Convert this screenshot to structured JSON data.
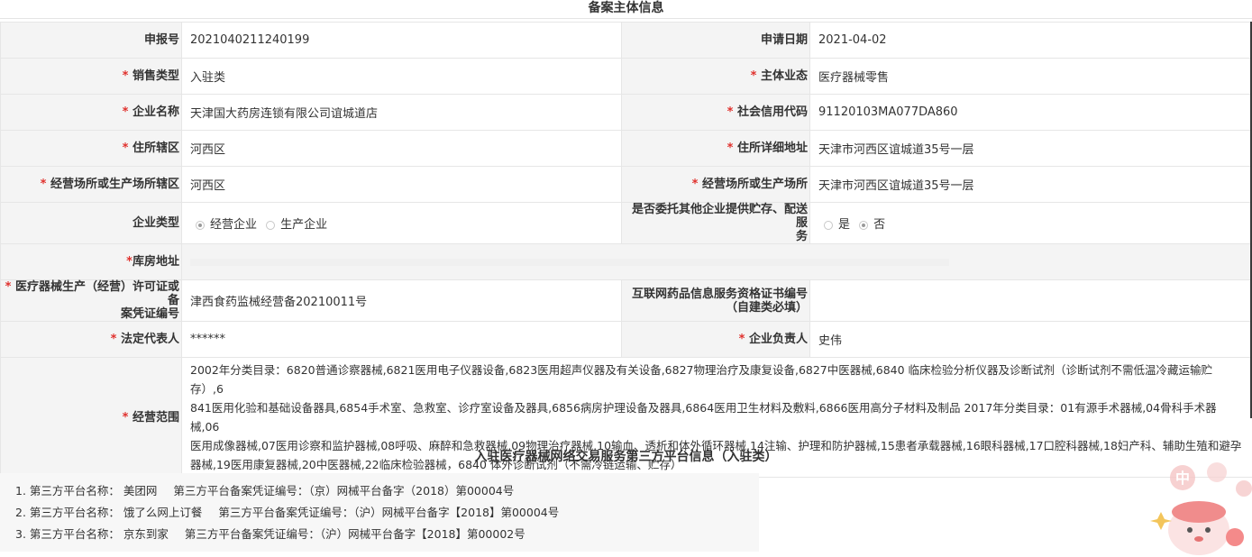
{
  "titles": {
    "main": "备案主体信息",
    "platforms": "入驻医疗器械网络交易服务第三方平台信息（入驻类）"
  },
  "required_mark": "*",
  "rows": {
    "report_no": {
      "label": "申报号",
      "value": "2021040211240199"
    },
    "apply_date": {
      "label": "申请日期",
      "value": "2021-04-02"
    },
    "sales_type": {
      "label": "销售类型",
      "value": "入驻类"
    },
    "business_format": {
      "label": "主体业态",
      "value": "医疗器械零售"
    },
    "company_name": {
      "label": "企业名称",
      "value": "天津国大药房连锁有限公司谊城道店"
    },
    "credit_code": {
      "label": "社会信用代码",
      "value": "91120103MA077DA860"
    },
    "residence_district": {
      "label": "住所辖区",
      "value": "河西区"
    },
    "residence_address": {
      "label": "住所详细地址",
      "value": "天津市河西区谊城道35号一层"
    },
    "premises_district": {
      "label": "经营场所或生产场所辖区",
      "value": "河西区"
    },
    "premises": {
      "label": "经营场所或生产场所",
      "value": "天津市河西区谊城道35号一层"
    },
    "company_type": {
      "label": "企业类型",
      "options": [
        {
          "label": "经营企业",
          "checked": true
        },
        {
          "label": "生产企业",
          "checked": false
        }
      ]
    },
    "entrust": {
      "label_line1": "是否委托其他企业提供贮存、配送服",
      "label_line2": "务",
      "options": [
        {
          "label": "是",
          "checked": false
        },
        {
          "label": "否",
          "checked": true
        }
      ]
    },
    "warehouse": {
      "label": "库房地址",
      "value": ""
    },
    "license": {
      "label_line1": "医疗器械生产（经营）许可证或备",
      "label_line2": "案凭证编号",
      "value": "津西食药监械经营备20210011号"
    },
    "internet_cert": {
      "label_line1": "互联网药品信息服务资格证书编号",
      "label_line2": "（自建类必填）",
      "value": ""
    },
    "legal_rep": {
      "label": "法定代表人",
      "value": "******"
    },
    "principal": {
      "label": "企业负责人",
      "value": "史伟"
    },
    "scope": {
      "label": "经营范围",
      "lines": [
        "2002年分类目录：6820普通诊察器械,6821医用电子仪器设备,6823医用超声仪器及有关设备,6827物理治疗及康复设备,6827中医器械,6840 临床检验分析仪器及诊断试剂（诊断试剂不需低温冷藏运输贮存）,6",
        "841医用化验和基础设备器具,6854手术室、急救室、诊疗室设备及器具,6856病房护理设备及器具,6864医用卫生材料及敷料,6866医用高分子材料及制品 2017年分类目录：01有源手术器械,04骨科手术器械,06",
        "医用成像器械,07医用诊察和监护器械,08呼吸、麻醉和急救器械,09物理治疗器械,10输血、透析和体外循环器械,14注输、护理和防护器械,15患者承载器械,16眼科器械,17口腔科器械,18妇产科、辅助生殖和避孕",
        "器械,19医用康复器械,20中医器械,22临床检验器械，6840 体外诊断试剂（不需冷链运输、贮存）"
      ]
    }
  },
  "platforms": [
    {
      "name_label": "1. 第三方平台名称：",
      "name": "美团网",
      "cert_label": "第三方平台备案凭证编号：",
      "cert": "（京）网械平台备字（2018）第00004号"
    },
    {
      "name_label": "2. 第三方平台名称：",
      "name": "饿了么网上订餐",
      "cert_label": "第三方平台备案凭证编号：",
      "cert": "（沪）网械平台备字【2018】第00004号"
    },
    {
      "name_label": "3. 第三方平台名称：",
      "name": "京东到家",
      "cert_label": "第三方平台备案凭证编号：",
      "cert": "（沪）网械平台备字【2018】第00002号"
    }
  ],
  "mascot_text": "中",
  "colors": {
    "required": "#e0302c",
    "label_bg": "#f4f4f4",
    "border": "#e6e6e6"
  }
}
